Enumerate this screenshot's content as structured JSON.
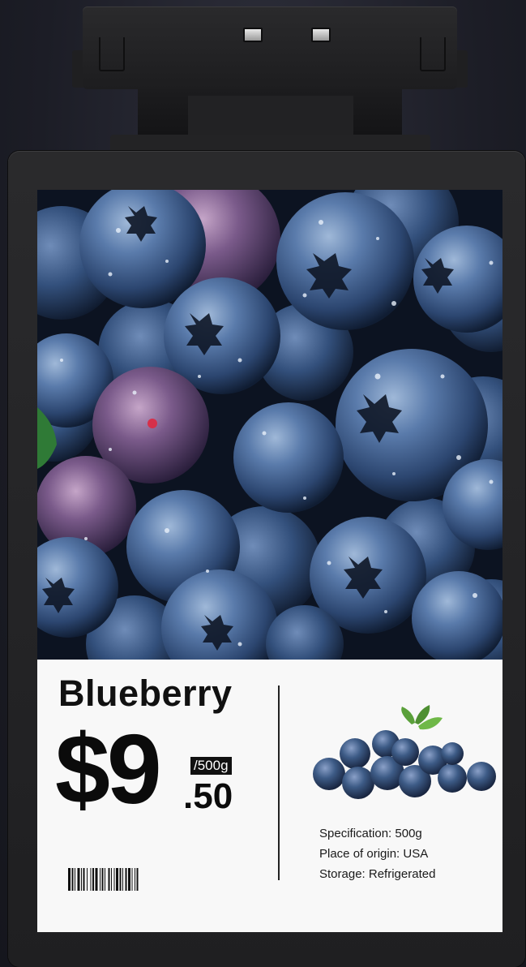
{
  "product": {
    "name": "Blueberry",
    "price_main": "$9",
    "price_unit": "/500g",
    "price_cents": ".50"
  },
  "specs": [
    "Specification: 500g",
    "Place of origin: USA",
    "Storage: Refrigerated"
  ],
  "icons": {
    "hero": "blueberries-photo",
    "thumbnail": "blueberry-cluster-image",
    "barcode": "barcode"
  },
  "colors": {
    "label_background": "#f8f8f8",
    "text": "#111111",
    "device_body": "#242426",
    "berry_blue": "#3d5b86"
  }
}
